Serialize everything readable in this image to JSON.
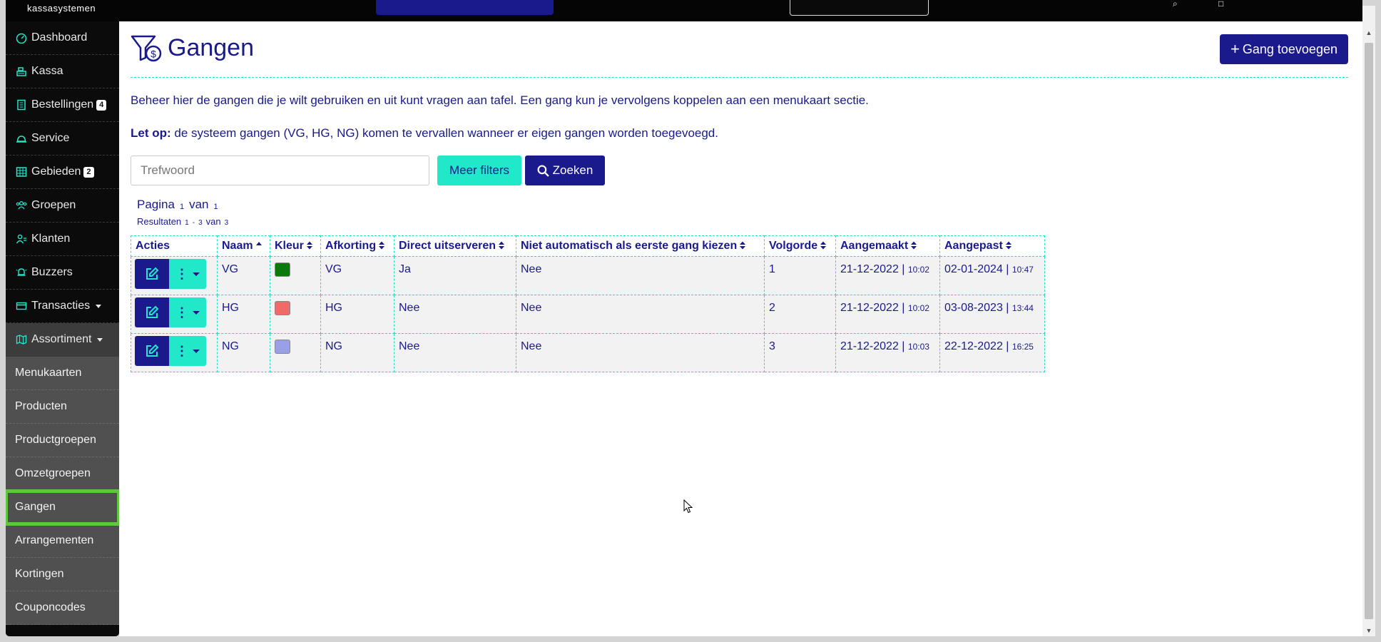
{
  "topbar": {
    "logo_text": "kassasystemen"
  },
  "sidebar": {
    "items": [
      {
        "label": "Dashboard",
        "icon": "gauge-icon",
        "badge": ""
      },
      {
        "label": "Kassa",
        "icon": "cash-register-icon",
        "badge": ""
      },
      {
        "label": "Bestellingen",
        "icon": "receipt-icon",
        "badge": "4"
      },
      {
        "label": "Service",
        "icon": "bell-service-icon",
        "badge": ""
      },
      {
        "label": "Gebieden",
        "icon": "grid-table-icon",
        "badge": "2"
      },
      {
        "label": "Groepen",
        "icon": "users-group-icon",
        "badge": ""
      },
      {
        "label": "Klanten",
        "icon": "user-icon",
        "badge": ""
      },
      {
        "label": "Buzzers",
        "icon": "buzzer-icon",
        "badge": ""
      },
      {
        "label": "Transacties",
        "icon": "credit-card-icon",
        "badge": ""
      },
      {
        "label": "Assortiment",
        "icon": "map-icon",
        "badge": ""
      }
    ],
    "submenu": [
      {
        "label": "Menukaarten"
      },
      {
        "label": "Producten"
      },
      {
        "label": "Productgroepen"
      },
      {
        "label": "Omzetgroepen"
      },
      {
        "label": "Gangen"
      },
      {
        "label": "Arrangementen"
      },
      {
        "label": "Kortingen"
      },
      {
        "label": "Couponcodes"
      }
    ]
  },
  "page": {
    "title": "Gangen",
    "add_button": "Gang toevoegen",
    "description": "Beheer hier de gangen die je wilt gebruiken en uit kunt vragen aan tafel. Een gang kun je vervolgens koppelen aan een menukaart sectie.",
    "note_bold": "Let op:",
    "note_text": " de systeem gangen (VG, HG, NG) komen te vervallen wanneer er eigen gangen worden toegevoegd."
  },
  "search": {
    "placeholder": "Trefwoord",
    "filters_label": "Meer filters",
    "search_label": "Zoeken"
  },
  "pagination": {
    "page_label": "Pagina",
    "page_current": "1",
    "of_label": "van",
    "page_total": "1",
    "results_label": "Resultaten",
    "results_from": "1",
    "results_sep": "-",
    "results_to": "3",
    "results_of": "van",
    "results_total": "3"
  },
  "table": {
    "headers": [
      "Acties",
      "Naam",
      "Kleur",
      "Afkorting",
      "Direct uitserveren",
      "Niet automatisch als eerste gang kiezen",
      "Volgorde",
      "Aangemaakt",
      "Aangepast"
    ],
    "rows": [
      {
        "naam": "VG",
        "kleur": "#0a7a0a",
        "afkorting": "VG",
        "direct": "Ja",
        "niet_auto": "Nee",
        "volgorde": "1",
        "created_date": "21-12-2022",
        "created_time": "10:02",
        "updated_date": "02-01-2024",
        "updated_time": "10:47"
      },
      {
        "naam": "HG",
        "kleur": "#f06a6a",
        "afkorting": "HG",
        "direct": "Nee",
        "niet_auto": "Nee",
        "volgorde": "2",
        "created_date": "21-12-2022",
        "created_time": "10:02",
        "updated_date": "03-08-2023",
        "updated_time": "13:44"
      },
      {
        "naam": "NG",
        "kleur": "#9aa0e8",
        "afkorting": "NG",
        "direct": "Nee",
        "niet_auto": "Nee",
        "volgorde": "3",
        "created_date": "21-12-2022",
        "created_time": "10:03",
        "updated_date": "22-12-2022",
        "updated_time": "16:25"
      }
    ]
  },
  "colors": {
    "primary": "#1a1a8c",
    "accent": "#20e8c8",
    "active_outline": "#5ec73e"
  }
}
